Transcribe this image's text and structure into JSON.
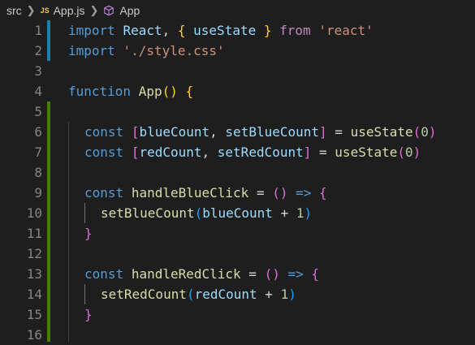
{
  "breadcrumb": {
    "folder": "src",
    "file_badge": "JS",
    "file": "App.js",
    "symbol": "App"
  },
  "lines": [
    {
      "num": "1",
      "tokens": [
        [
          "k",
          "import"
        ],
        [
          "p",
          " "
        ],
        [
          "v",
          "React"
        ],
        [
          "p",
          ", "
        ],
        [
          "b1",
          "{"
        ],
        [
          "p",
          " "
        ],
        [
          "v",
          "useState"
        ],
        [
          "p",
          " "
        ],
        [
          "b1",
          "}"
        ],
        [
          "p",
          " "
        ],
        [
          "im",
          "from"
        ],
        [
          "p",
          " "
        ],
        [
          "s",
          "'react'"
        ]
      ]
    },
    {
      "num": "2",
      "tokens": [
        [
          "k",
          "import"
        ],
        [
          "p",
          " "
        ],
        [
          "s",
          "'./style.css'"
        ]
      ]
    },
    {
      "num": "3",
      "tokens": []
    },
    {
      "num": "4",
      "tokens": [
        [
          "k",
          "function"
        ],
        [
          "p",
          " "
        ],
        [
          "f",
          "App"
        ],
        [
          "b1",
          "()"
        ],
        [
          "p",
          " "
        ],
        [
          "b1",
          "{"
        ]
      ]
    },
    {
      "num": "5",
      "tokens": []
    },
    {
      "num": "6",
      "tokens": [
        [
          "k",
          "const"
        ],
        [
          "p",
          " "
        ],
        [
          "b2",
          "["
        ],
        [
          "v",
          "blueCount"
        ],
        [
          "p",
          ", "
        ],
        [
          "v",
          "setBlueCount"
        ],
        [
          "b2",
          "]"
        ],
        [
          "p",
          " = "
        ],
        [
          "f",
          "useState"
        ],
        [
          "b2",
          "("
        ],
        [
          "n",
          "0"
        ],
        [
          "b2",
          ")"
        ]
      ]
    },
    {
      "num": "7",
      "tokens": [
        [
          "k",
          "const"
        ],
        [
          "p",
          " "
        ],
        [
          "b2",
          "["
        ],
        [
          "v",
          "redCount"
        ],
        [
          "p",
          ", "
        ],
        [
          "v",
          "setRedCount"
        ],
        [
          "b2",
          "]"
        ],
        [
          "p",
          " = "
        ],
        [
          "f",
          "useState"
        ],
        [
          "b2",
          "("
        ],
        [
          "n",
          "0"
        ],
        [
          "b2",
          ")"
        ]
      ]
    },
    {
      "num": "8",
      "tokens": []
    },
    {
      "num": "9",
      "tokens": [
        [
          "k",
          "const"
        ],
        [
          "p",
          " "
        ],
        [
          "f",
          "handleBlueClick"
        ],
        [
          "p",
          " = "
        ],
        [
          "b2",
          "()"
        ],
        [
          "p",
          " "
        ],
        [
          "k",
          "=>"
        ],
        [
          "p",
          " "
        ],
        [
          "b2",
          "{"
        ]
      ]
    },
    {
      "num": "10",
      "tokens": [
        [
          "f",
          "setBlueCount"
        ],
        [
          "b3",
          "("
        ],
        [
          "v",
          "blueCount"
        ],
        [
          "p",
          " + "
        ],
        [
          "n",
          "1"
        ],
        [
          "b3",
          ")"
        ]
      ]
    },
    {
      "num": "11",
      "tokens": [
        [
          "b2",
          "}"
        ]
      ]
    },
    {
      "num": "12",
      "tokens": []
    },
    {
      "num": "13",
      "tokens": [
        [
          "k",
          "const"
        ],
        [
          "p",
          " "
        ],
        [
          "f",
          "handleRedClick"
        ],
        [
          "p",
          " = "
        ],
        [
          "b2",
          "()"
        ],
        [
          "p",
          " "
        ],
        [
          "k",
          "=>"
        ],
        [
          "p",
          " "
        ],
        [
          "b2",
          "{"
        ]
      ]
    },
    {
      "num": "14",
      "tokens": [
        [
          "f",
          "setRedCount"
        ],
        [
          "b3",
          "("
        ],
        [
          "v",
          "redCount"
        ],
        [
          "p",
          " + "
        ],
        [
          "n",
          "1"
        ],
        [
          "b3",
          ")"
        ]
      ]
    },
    {
      "num": "15",
      "tokens": [
        [
          "b2",
          "}"
        ]
      ]
    },
    {
      "num": "16",
      "tokens": []
    }
  ],
  "colors": {
    "background": "#1e1e1e",
    "git_modified": "#1b81a8",
    "git_added": "#487e02"
  }
}
